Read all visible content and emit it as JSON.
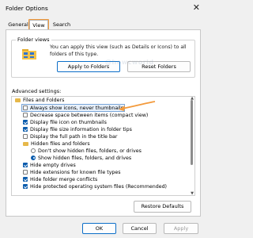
{
  "window": {
    "title": "Folder Options"
  },
  "tabs": [
    {
      "label": "General"
    },
    {
      "label": "View"
    },
    {
      "label": "Search"
    }
  ],
  "folder_views": {
    "legend": "Folder views",
    "description": "You can apply this view (such as Details or Icons) to all folders of this type.",
    "apply_button": "Apply to Folders",
    "reset_button": "Reset Folders",
    "icon": "folder-icon"
  },
  "watermark": "@howcworld",
  "advanced": {
    "label": "Advanced settings:",
    "items": [
      {
        "kind": "folder",
        "label": "Files and Folders"
      },
      {
        "kind": "checkbox",
        "checked": false,
        "label": "Always show icons, never thumbnails"
      },
      {
        "kind": "checkbox",
        "checked": false,
        "label": "Decrease space between items (compact view)"
      },
      {
        "kind": "checkbox",
        "checked": true,
        "label": "Display file icon on thumbnails"
      },
      {
        "kind": "checkbox",
        "checked": true,
        "label": "Display file size information in folder tips"
      },
      {
        "kind": "checkbox",
        "checked": false,
        "label": "Display the full path in the title bar"
      },
      {
        "kind": "folder",
        "label": "Hidden files and folders"
      },
      {
        "kind": "radio",
        "checked": false,
        "label": "Don't show hidden files, folders, or drives"
      },
      {
        "kind": "radio",
        "checked": true,
        "label": "Show hidden files, folders, and drives"
      },
      {
        "kind": "checkbox",
        "checked": true,
        "label": "Hide empty drives"
      },
      {
        "kind": "checkbox",
        "checked": false,
        "label": "Hide extensions for known file types"
      },
      {
        "kind": "checkbox",
        "checked": true,
        "label": "Hide folder merge conflicts"
      },
      {
        "kind": "checkbox",
        "checked": true,
        "label": "Hide protected operating system files (Recommended)"
      }
    ],
    "restore_button": "Restore Defaults"
  },
  "footer": {
    "ok": "OK",
    "cancel": "Cancel",
    "apply": "Apply"
  },
  "colors": {
    "accent": "#0b5cad",
    "highlight": "#f39a3b"
  }
}
